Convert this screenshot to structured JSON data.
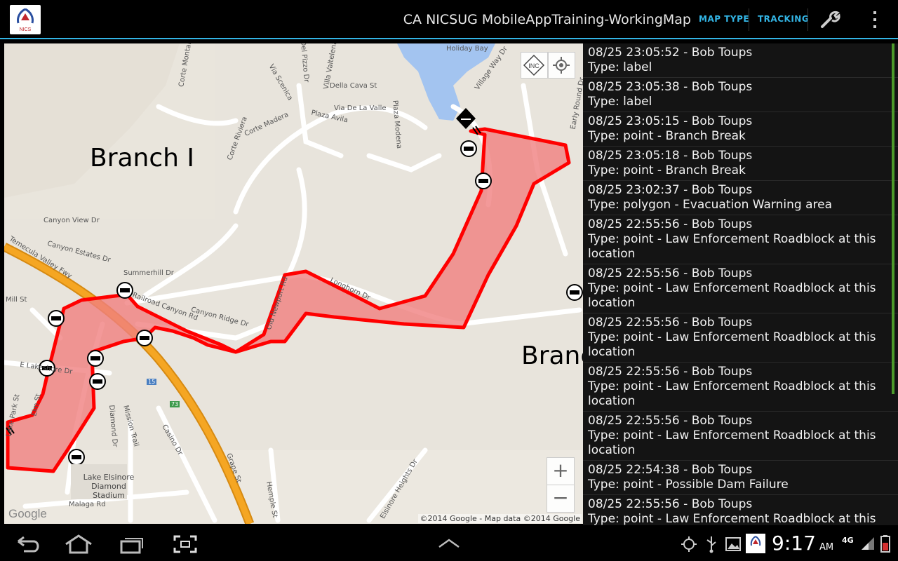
{
  "app": {
    "title": "CA NICSUG MobileAppTraining-WorkingMap",
    "logo_text": "NICS"
  },
  "actionbar": {
    "map_type_label": "MAP TYPE",
    "tracking_label": "TRACKING"
  },
  "map": {
    "branch_labels": [
      "Branch I",
      "Branc"
    ],
    "inc_button_label": "INC",
    "zoom_in_label": "+",
    "zoom_out_label": "−",
    "copyright": "©2014 Google - Map data ©2014 Google",
    "google_logo": "Google",
    "street_labels": [
      "Corte Montana",
      "Via Scenica",
      "Del Pizzo Dr",
      "Villa Valtelena",
      "Della Cava St",
      "Via De La Valle",
      "Plaza Avila",
      "Plaza Modena",
      "Corte Riviera",
      "Corte Madera",
      "Canyon View Dr",
      "Canyon Estates Dr",
      "Summerhill Dr",
      "Temecula Valley Fwy",
      "Mill St",
      "Railroad Canyon Rd",
      "Canyon Ridge Dr",
      "Old Newport Rd",
      "Longhorn Dr",
      "E Lakeshore Dr",
      "Lake Park St",
      "Elm St",
      "Diamond Dr",
      "Mission Trail",
      "Casino Dr",
      "Grape St",
      "Hemple St",
      "Elsinore Heights Dr",
      "Malaga Rd",
      "Village Way Dr",
      "Early Round Dr",
      "Holiday Bay",
      "Lake Elsinore Diamond Stadium",
      "15",
      "73"
    ]
  },
  "log": {
    "items": [
      {
        "header": "08/25 23:05:52 - Bob Toups",
        "type": "Type: label"
      },
      {
        "header": "08/25 23:05:38 - Bob Toups",
        "type": "Type: label"
      },
      {
        "header": "08/25 23:05:15 - Bob Toups",
        "type": "Type: point - Branch Break"
      },
      {
        "header": "08/25 23:05:18 - Bob Toups",
        "type": "Type: point - Branch Break"
      },
      {
        "header": "08/25 23:02:37 - Bob Toups",
        "type": "Type: polygon - Evacuation Warning area"
      },
      {
        "header": "08/25 22:55:56 - Bob Toups",
        "type": "Type: point - Law Enforcement Roadblock at this location"
      },
      {
        "header": "08/25 22:55:56 - Bob Toups",
        "type": "Type: point - Law Enforcement Roadblock at this location"
      },
      {
        "header": "08/25 22:55:56 - Bob Toups",
        "type": "Type: point - Law Enforcement Roadblock at this location"
      },
      {
        "header": "08/25 22:55:56 - Bob Toups",
        "type": "Type: point - Law Enforcement Roadblock at this location"
      },
      {
        "header": "08/25 22:55:56 - Bob Toups",
        "type": "Type: point - Law Enforcement Roadblock at this location"
      },
      {
        "header": "08/25 22:54:38 - Bob Toups",
        "type": "Type: point - Possible Dam Failure"
      },
      {
        "header": "08/25 22:55:56 - Bob Toups",
        "type": "Type: point - Law Enforcement Roadblock at this location"
      }
    ]
  },
  "status": {
    "time": "9:17",
    "ampm": "AM",
    "network": "4G"
  },
  "colors": {
    "accent": "#33b5e5",
    "polygon_stroke": "#ff0000",
    "polygon_fill": "#f08080",
    "freeway": "#f5a623"
  }
}
